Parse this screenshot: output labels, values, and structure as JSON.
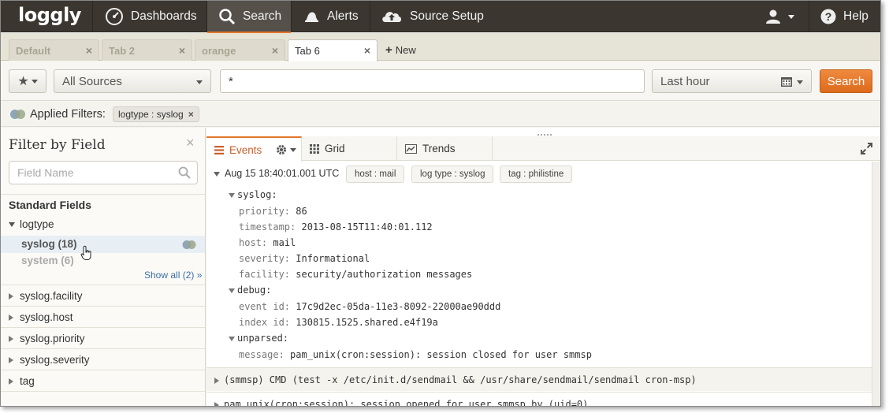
{
  "nav": {
    "logo": "loggly",
    "items": [
      {
        "label": "Dashboards",
        "icon": "gauge-icon"
      },
      {
        "label": "Search",
        "icon": "search-icon",
        "active": true
      },
      {
        "label": "Alerts",
        "icon": "bell-icon"
      },
      {
        "label": "Source Setup",
        "icon": "cloud-upload-icon"
      }
    ],
    "help": "Help",
    "user_icon": "user-icon"
  },
  "tabs": [
    {
      "label": "Default"
    },
    {
      "label": "Tab 2"
    },
    {
      "label": "orange"
    },
    {
      "label": "Tab 6",
      "active": true
    }
  ],
  "new_tab": "New",
  "search": {
    "source": "All Sources",
    "query": "*",
    "time": "Last hour",
    "button": "Search"
  },
  "filters": {
    "label": "Applied Filters:",
    "pills": [
      "logtype : syslog"
    ]
  },
  "sidebar": {
    "title": "Filter by Field",
    "placeholder": "Field Name",
    "section": "Standard Fields",
    "group": "logtype",
    "values": [
      {
        "label": "syslog (18)",
        "selected": true
      },
      {
        "label": "system (6)"
      }
    ],
    "show_all": "Show all (2) »",
    "fields": [
      "syslog.facility",
      "syslog.host",
      "syslog.priority",
      "syslog.severity",
      "tag"
    ]
  },
  "views": {
    "events": "Events",
    "grid": "Grid",
    "trends": "Trends"
  },
  "event": {
    "timestamp": "Aug 15 18:40:01.001 UTC",
    "tags": [
      "host : mail",
      "log type : syslog",
      "tag : philistine"
    ],
    "sections": [
      {
        "name": "syslog:",
        "fields": [
          {
            "k": "priority:",
            "v": "86"
          },
          {
            "k": "timestamp:",
            "v": "2013-08-15T11:40:01.112"
          },
          {
            "k": "host:",
            "v": "mail"
          },
          {
            "k": "severity:",
            "v": "Informational"
          },
          {
            "k": "facility:",
            "v": "security/authorization messages"
          }
        ]
      },
      {
        "name": "debug:",
        "fields": [
          {
            "k": "event id:",
            "v": "17c9d2ec-05da-11e3-8092-22000ae90ddd"
          },
          {
            "k": "index id:",
            "v": "130815.1525.shared.e4f19a"
          }
        ]
      },
      {
        "name": "unparsed:",
        "fields": [
          {
            "k": "message:",
            "v": "pam_unix(cron:session): session closed for user smmsp"
          }
        ]
      }
    ]
  },
  "more_events": [
    "(smmsp) CMD (test -x /etc/init.d/sendmail && /usr/share/sendmail/sendmail cron-msp)",
    "pam_unix(cron:session): session opened for user smmsp by (uid=0)"
  ]
}
